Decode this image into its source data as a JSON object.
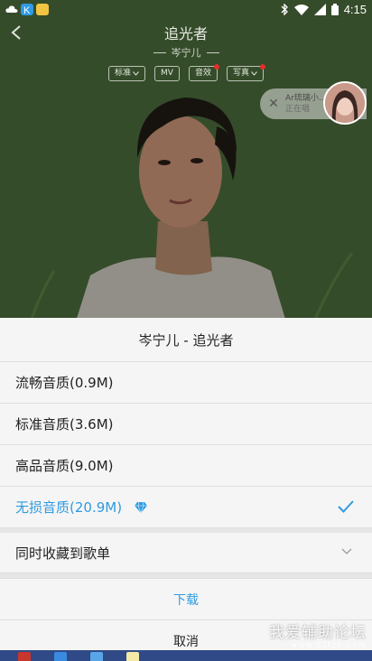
{
  "status_bar": {
    "time": "4:15",
    "left_icons": [
      "cloud-icon",
      "k-app-icon",
      "multi-app-icon"
    ],
    "right_icons": [
      "bluetooth-off-icon",
      "wifi-icon",
      "signal-icon",
      "battery-icon"
    ]
  },
  "header": {
    "song_title": "追光者",
    "artist": "岑宁儿",
    "chips": [
      {
        "label": "标准",
        "has_dropdown": true,
        "red_dot": false
      },
      {
        "label": "MV",
        "has_dropdown": false,
        "red_dot": false
      },
      {
        "label": "音效",
        "has_dropdown": false,
        "red_dot": true
      },
      {
        "label": "写真",
        "has_dropdown": true,
        "red_dot": true
      }
    ]
  },
  "mini_player": {
    "title": "Ar琉璃小...",
    "status": "正在唱"
  },
  "sheet": {
    "title": "岑宁儿 - 追光者",
    "options": [
      {
        "label": "流畅音质(0.9M)",
        "selected": false
      },
      {
        "label": "标准音质(3.6M)",
        "selected": false
      },
      {
        "label": "高品音质(9.0M)",
        "selected": false
      },
      {
        "label": "无损音质(20.9M)",
        "selected": true
      }
    ],
    "collect_label": "同时收藏到歌单",
    "download_label": "下载",
    "cancel_label": "取消"
  },
  "watermark": {
    "line1": "我爱辅助论坛",
    "line2": "www.52fzb.com"
  },
  "colors": {
    "accent": "#2f9be0",
    "sheet_bg": "#f5f5f5",
    "red_dot": "#e0302c"
  }
}
